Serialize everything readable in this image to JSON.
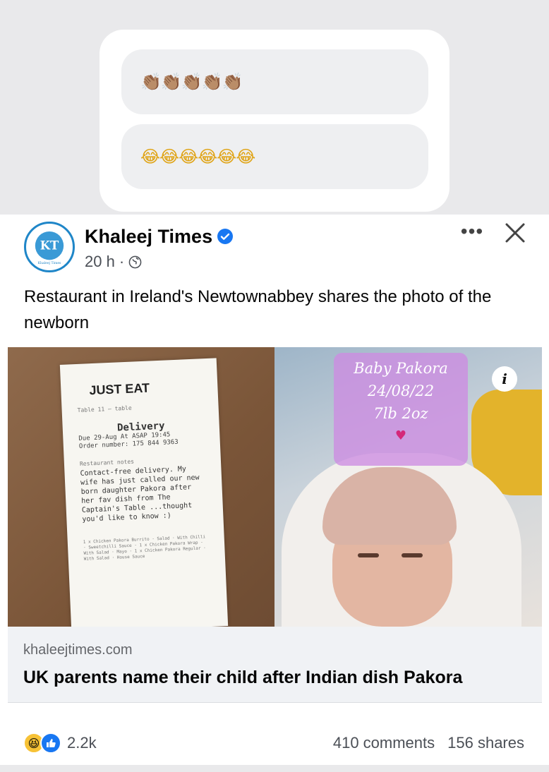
{
  "comments": [
    {
      "text": "👏🏽👏🏽👏🏽👏🏽👏🏽"
    },
    {
      "text": "😂😂😂😂😂😂"
    }
  ],
  "post": {
    "page_name": "Khaleej Times",
    "avatar_text": "KT",
    "avatar_subtext": "Khaleej Times",
    "time": "20 h",
    "separator": "·",
    "more_label": "•••",
    "caption": "Restaurant in Ireland's Newtownabbey shares the photo of the newborn",
    "image": {
      "receipt_brand": "JUST EAT",
      "receipt_table": "Table 11 — table",
      "receipt_delivery": "Delivery",
      "receipt_due": "Due 29-Aug At ASAP 19:45",
      "receipt_order": "Order number: 175 844 9363",
      "receipt_note_label": "Restaurant notes",
      "receipt_note": "Contact-free delivery. My wife has just called our new born daughter Pakora after her fav dish from The Captain's Table ...thought you'd like to know :)",
      "receipt_items": "1 x Chicken Pakora Burrito · Salad · With Chilli · Sweetchilli Sauce · 1 x Chicken Pakora Wrap · With Salad · Mayo · 1 x Chicken Pakora Regular · With Salad · House Sauce",
      "overlay_name": "Baby Pakora",
      "overlay_date": "24/08/22",
      "overlay_weight": "7lb 2oz",
      "info_label": "i"
    },
    "link": {
      "domain": "khaleejtimes.com",
      "headline": "UK parents name their child after Indian dish Pakora"
    },
    "reactions": {
      "count": "2.2k",
      "comments": "410 comments",
      "shares": "156 shares"
    }
  },
  "colors": {
    "verified_blue": "#1877f2",
    "avatar_blue": "#1f86c8",
    "overlay_purple": "#cd8ce1"
  }
}
